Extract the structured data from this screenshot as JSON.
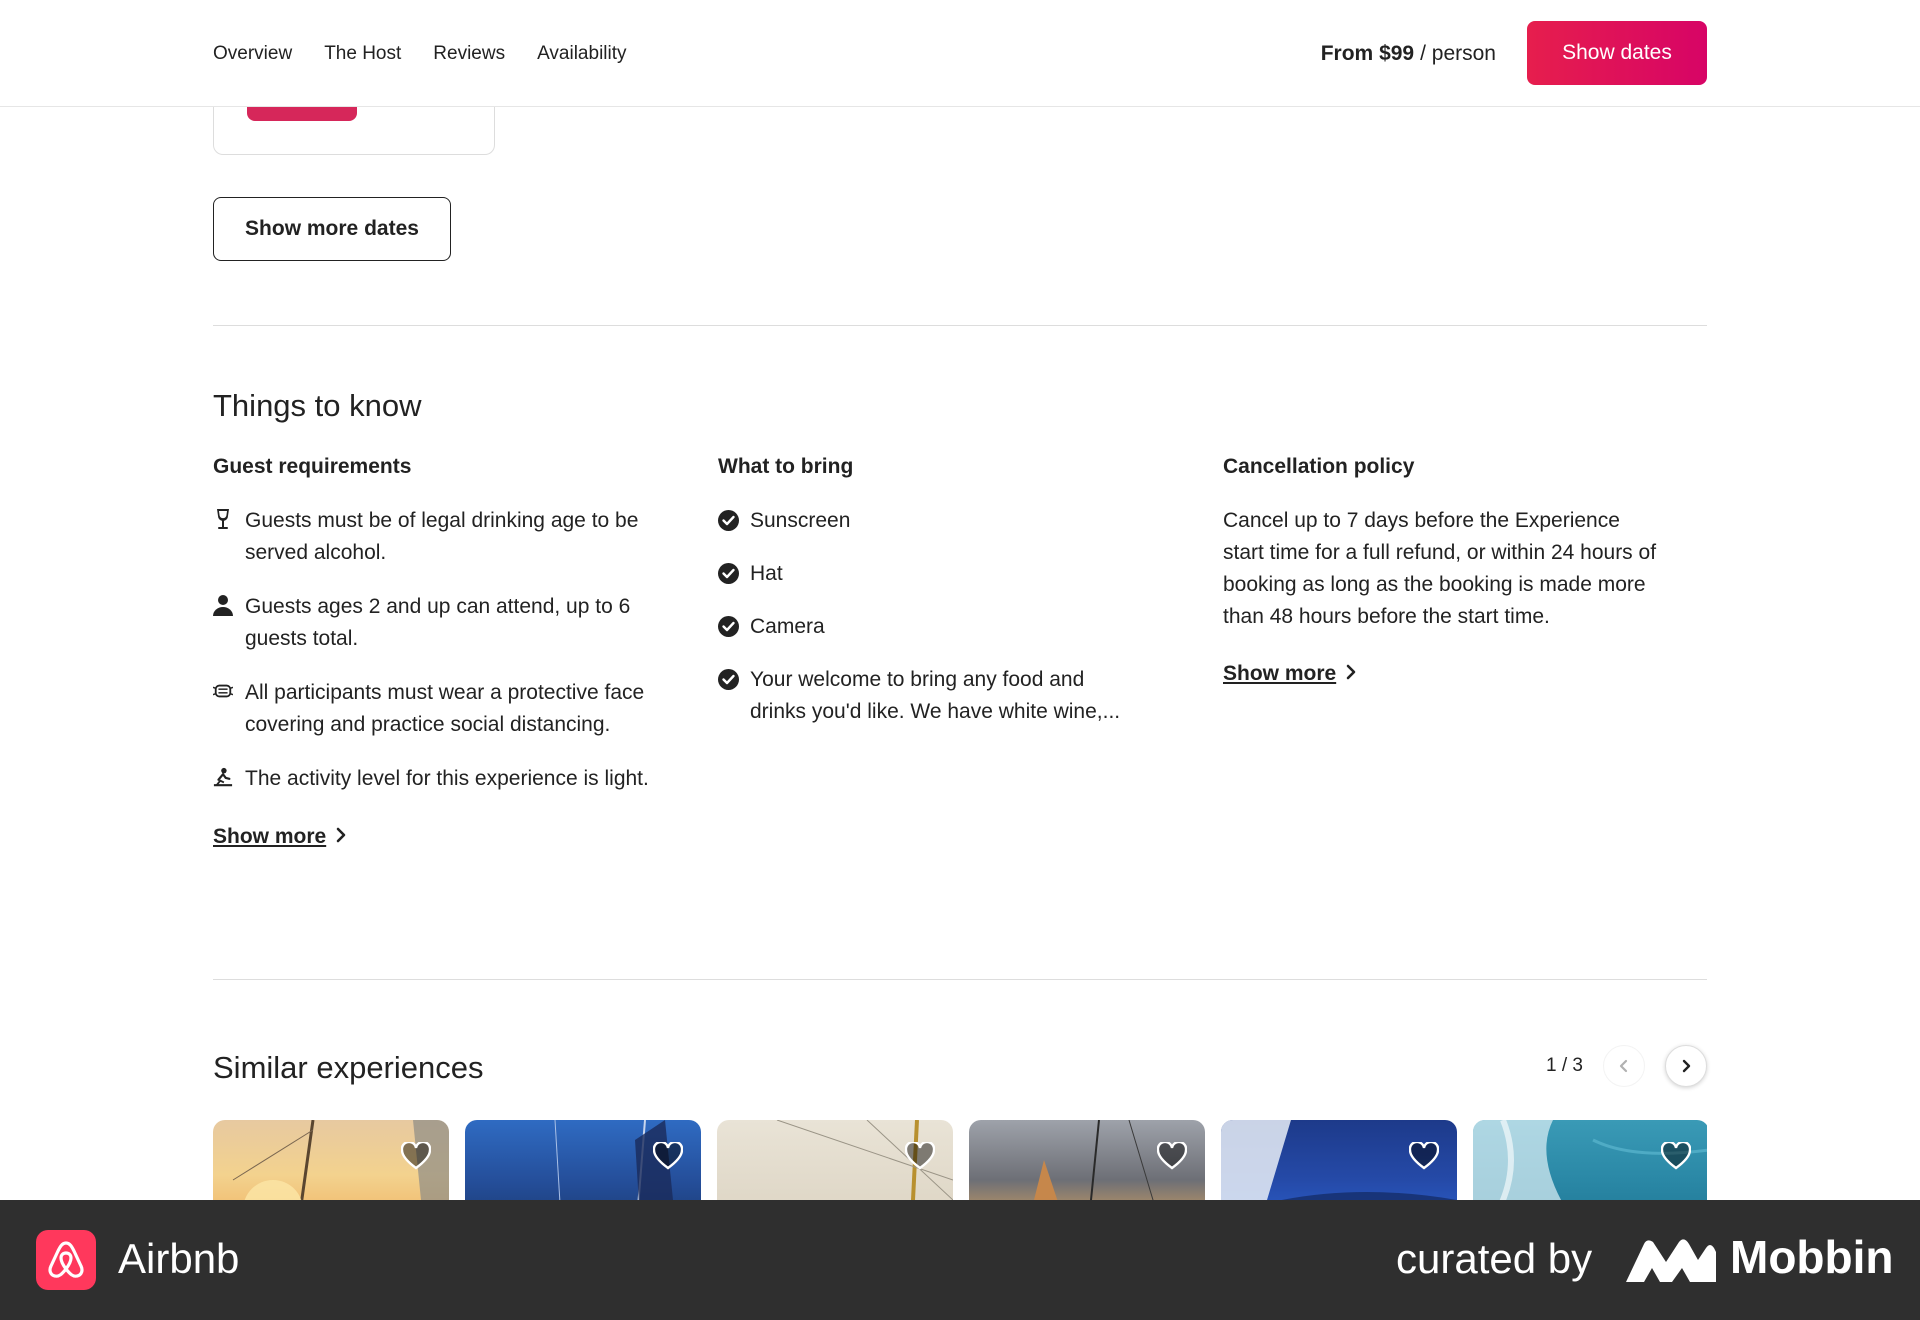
{
  "nav": {
    "links": [
      "Overview",
      "The Host",
      "Reviews",
      "Availability"
    ],
    "price_from": "From $99",
    "price_unit": "/ person",
    "cta_label": "Show dates"
  },
  "availability": {
    "show_more_dates_label": "Show more dates"
  },
  "things_to_know": {
    "title": "Things to know",
    "guest_requirements": {
      "heading": "Guest requirements",
      "items": [
        {
          "icon": "wine-glass-icon",
          "text": "Guests must be of legal drinking age to be served alcohol."
        },
        {
          "icon": "person-icon",
          "text": "Guests ages 2 and up can attend, up to 6 guests total."
        },
        {
          "icon": "face-mask-icon",
          "text": "All participants must wear a protective face covering and practice social distancing."
        },
        {
          "icon": "activity-level-icon",
          "text": "The activity level for this experience is light."
        }
      ],
      "show_more_label": "Show more"
    },
    "what_to_bring": {
      "heading": "What to bring",
      "items": [
        "Sunscreen",
        "Hat",
        "Camera",
        "Your welcome to bring any food and drinks you'd like. We have white wine,..."
      ]
    },
    "cancellation_policy": {
      "heading": "Cancellation policy",
      "text": "Cancel up to 7 days before the Experience start time for a full refund, or within 24 hours of booking as long as the booking is made more than 48 hours before the start time.",
      "show_more_label": "Show more"
    }
  },
  "similar": {
    "title": "Similar experiences",
    "page_indicator": "1 / 3",
    "cards": [
      "sunset-sailing",
      "blue-sky-mast",
      "sail-canvas",
      "dusk-sail",
      "blue-deck",
      "ocean-wake"
    ]
  },
  "footer": {
    "brand": "Airbnb",
    "curated_by": "curated by",
    "curator": "Mobbin"
  },
  "colors": {
    "brand": "#ff385c",
    "cta_start": "#e61e4d",
    "cta_end": "#d70466",
    "footer_bg": "#2f2f2f"
  }
}
